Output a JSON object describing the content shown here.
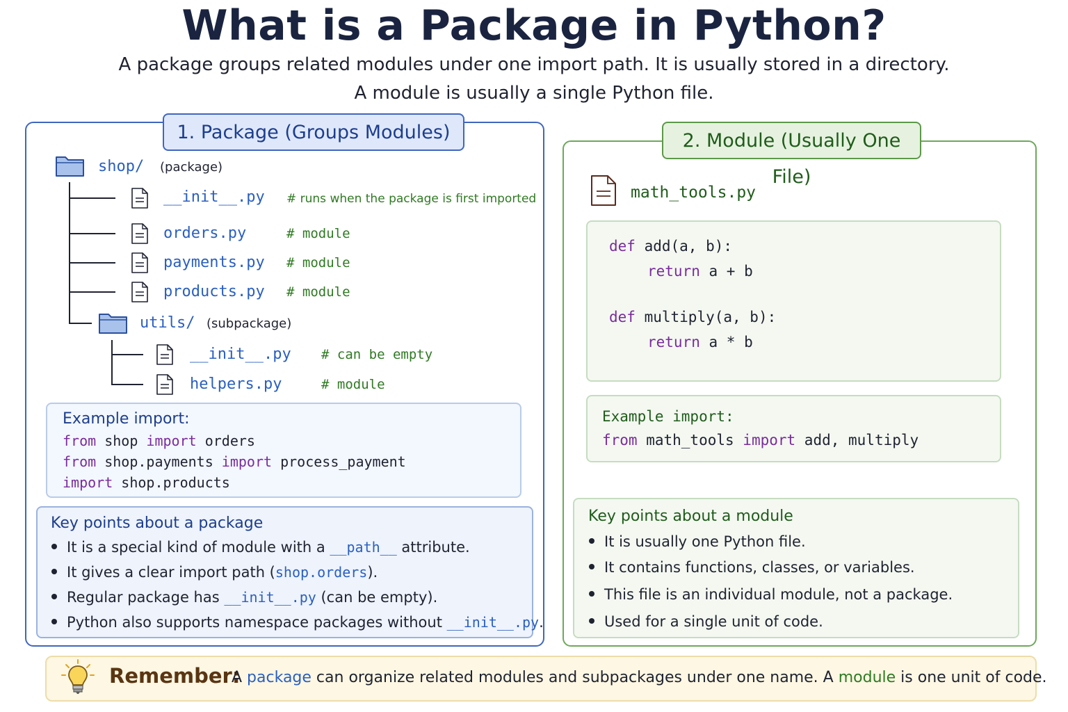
{
  "title": "What is a Package in Python?",
  "subtitle_line1": "A package groups related modules under one import path. It is usually stored in a directory.",
  "subtitle_line2": "A module is usually a single Python file.",
  "package_panel": {
    "title": "1. Package (Groups Modules)",
    "root": {
      "name": "shop/",
      "note": "(package)"
    },
    "files": [
      {
        "name": "__init__.py",
        "comment": "# runs when the package is first imported"
      },
      {
        "name": "orders.py",
        "comment": "# module"
      },
      {
        "name": "payments.py",
        "comment": "# module"
      },
      {
        "name": "products.py",
        "comment": "# module"
      }
    ],
    "subpackage": {
      "name": "utils/",
      "note": "(subpackage)"
    },
    "sub_files": [
      {
        "name": "__init__.py",
        "comment": "# can be empty"
      },
      {
        "name": "helpers.py",
        "comment": "# module"
      }
    ],
    "example": {
      "heading": "Example import:",
      "lines": [
        {
          "kw1": "from",
          "mid": " shop ",
          "kw2": "import",
          "rest": " orders"
        },
        {
          "kw1": "from",
          "mid": " shop.payments ",
          "kw2": "import",
          "rest": " process_payment"
        },
        {
          "kw1": "import",
          "mid": " shop.products",
          "kw2": "",
          "rest": ""
        }
      ]
    },
    "key_points": {
      "heading": "Key points about a package",
      "b1_pre": "It is a special kind of module with a ",
      "b1_code": "__path__",
      "b1_post": " attribute.",
      "b2_pre": "It gives a clear import path (",
      "b2_code": "shop.orders",
      "b2_post": ").",
      "b3_pre": "Regular package has ",
      "b3_code": "__init__.py",
      "b3_post": " (can be empty).",
      "b4_pre": "Python also supports namespace packages without ",
      "b4_code": "__init__.py",
      "b4_post": "."
    }
  },
  "module_panel": {
    "title": "2. Module (Usually One File)",
    "file_name": "math_tools.py",
    "code": {
      "l1_kw": "def",
      "l1_rest": " add(a, b):",
      "l2_kw": "return",
      "l2_rest": " a + b",
      "l3_kw": "def",
      "l3_rest": " multiply(a, b):",
      "l4_kw": "return",
      "l4_rest": " a * b"
    },
    "example": {
      "heading": "Example import:",
      "kw1": "from",
      "mid": " math_tools ",
      "kw2": "import",
      "rest": " add, multiply"
    },
    "key_points": {
      "heading": "Key points about a module",
      "items": [
        "It is usually one Python file.",
        "It contains functions, classes, or variables.",
        "This file is an individual module, not a package.",
        "Used for a single unit of code."
      ]
    }
  },
  "remember": {
    "label": "Remember:",
    "t1": "A ",
    "w1": "package",
    "t2": " can organize related modules and subpackages under one name.  A ",
    "w2": "module",
    "t3": " is one unit of code."
  },
  "colors": {
    "package_accent": "#3f66c0",
    "module_accent": "#6ea85a",
    "keyword": "#7a2b9c",
    "comment": "#2f7a22",
    "filename": "#2a5fc0",
    "remember_bg": "#fdf7e3"
  },
  "icons": {
    "folder": "folder-icon",
    "file": "file-icon",
    "lightbulb": "lightbulb-icon"
  }
}
